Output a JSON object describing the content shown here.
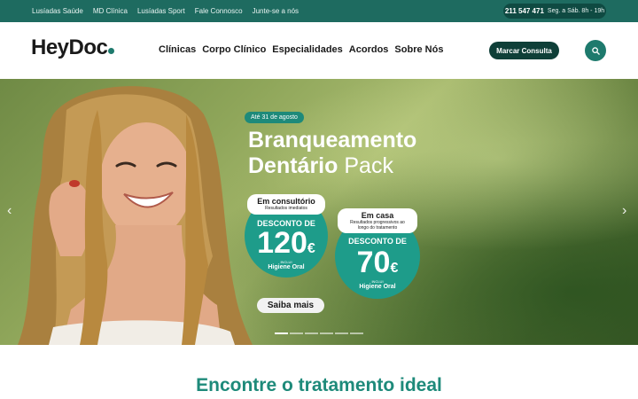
{
  "topbar": {
    "links": [
      "Lusíadas Saúde",
      "MD Clínica",
      "Lusíadas Sport",
      "Fale Connosco",
      "Junte-se a nós"
    ],
    "phone": "211 547 471",
    "hours": "Seg. a Sáb. 8h - 19h"
  },
  "header": {
    "logo": "HeyDoc",
    "nav": [
      "Clínicas",
      "Corpo Clínico",
      "Especialidades",
      "Acordos",
      "Sobre Nós"
    ],
    "cta_label": "Marcar Consulta",
    "search_icon": "search-icon"
  },
  "hero": {
    "date_badge": "Até 31 de agosto",
    "title_line1": "Branqueamento",
    "title_line2_bold": "Dentário",
    "title_line2_light": "Pack",
    "offer1": {
      "pill_title": "Em consultório",
      "pill_sub": "Resultados imediatos",
      "desc": "DESCONTO DE",
      "price": "120",
      "currency": "€",
      "inclui": "INCLUI",
      "sub": "Higiene Oral"
    },
    "offer2": {
      "pill_title": "Em casa",
      "pill_sub": "Resultados progressivos ao longo do tratamento",
      "desc": "DESCONTO DE",
      "price": "70",
      "currency": "€",
      "inclui": "INCLUI",
      "sub": "Higiene Oral"
    },
    "more_label": "Saiba mais",
    "slide_count": 6,
    "active_slide": 1
  },
  "section": {
    "title": "Encontre o tratamento ideal"
  },
  "colors": {
    "brand_dark": "#0f3f38",
    "brand": "#1e7a6d",
    "accent": "#1e9c8a",
    "topbar": "#1e6b60"
  }
}
